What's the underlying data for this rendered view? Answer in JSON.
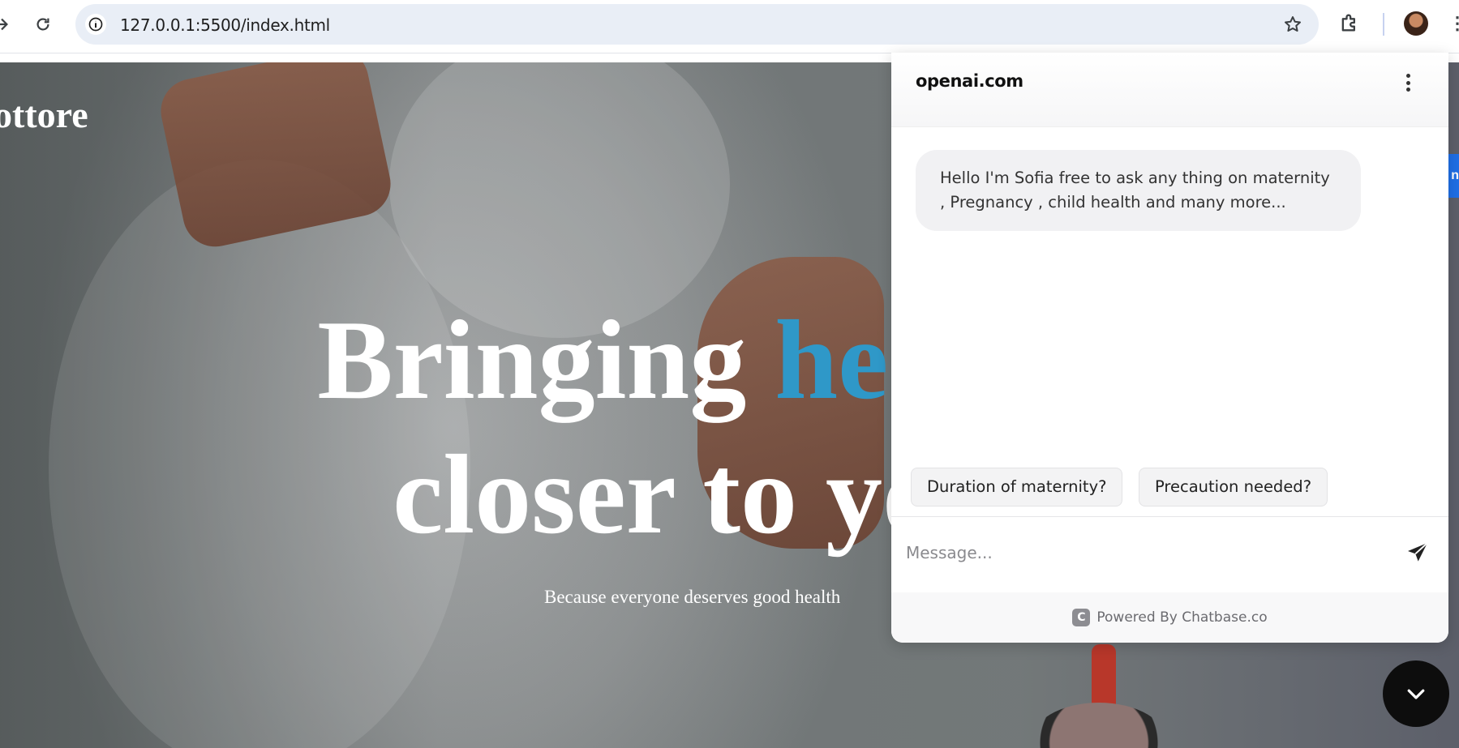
{
  "browser": {
    "url": "127.0.0.1:5500/index.html",
    "icons": [
      "forward-icon",
      "reload-icon",
      "site-info-icon",
      "bookmark-star-icon",
      "extensions-icon",
      "profile-avatar",
      "more-icon"
    ]
  },
  "hero": {
    "brand": "ottore",
    "title_line1_prefix": "Bringing ",
    "title_line1_accent": "health",
    "title_line2": "closer to you",
    "subtitle": "Because everyone deserves good health",
    "accent_color": "#2f98c8"
  },
  "chat": {
    "title": "openai.com",
    "greeting": "Hello I'm Sofia free to ask any thing on maternity , Pregnancy , child health and many more...",
    "suggestions": [
      "Duration of maternity?",
      "Precaution needed?"
    ],
    "input_placeholder": "Message...",
    "footer_prefix": "Powered By ",
    "footer_brand": "Chatbase.co",
    "logo_letter": "C"
  },
  "colors": {
    "toggle_button": "#0d0d0d",
    "url_bar": "#e9eef6"
  }
}
